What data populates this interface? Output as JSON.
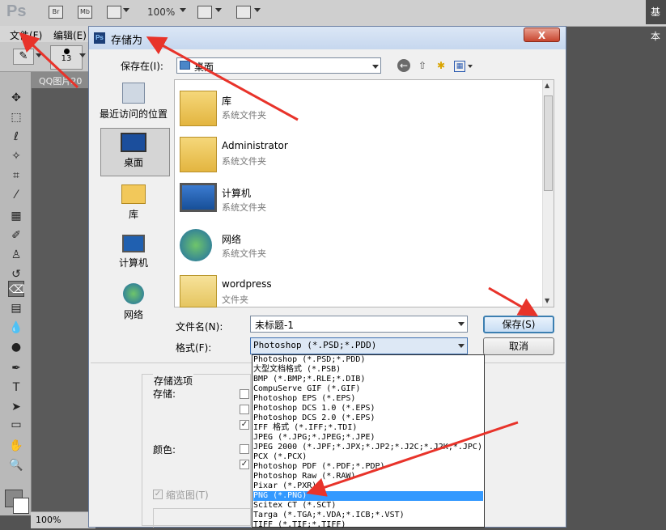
{
  "ps": {
    "logo": "Ps",
    "bridge_label": "Br",
    "minibridge_label": "Mb",
    "zoom": "100%",
    "workspace_label": "基本",
    "menu": [
      "文件(F)",
      "编辑(E)"
    ],
    "brush_size": "13",
    "doc_tab": "QQ图片20",
    "status_zoom": "100%"
  },
  "dialog": {
    "title": "存储为",
    "close_symbol": "X",
    "save_in_label": "保存在(I):",
    "save_in_value": "桌面",
    "places": [
      "最近访问的位置",
      "桌面",
      "库",
      "计算机",
      "网络"
    ],
    "files": [
      {
        "name": "库",
        "type": "系统文件夹"
      },
      {
        "name": "Administrator",
        "type": "系统文件夹"
      },
      {
        "name": "计算机",
        "type": "系统文件夹"
      },
      {
        "name": "网络",
        "type": "系统文件夹"
      },
      {
        "name": "wordpress",
        "type": "文件夹"
      }
    ],
    "filename_label": "文件名(N):",
    "filename_value": "未标题-1",
    "format_label": "格式(F):",
    "format_value": "Photoshop (*.PSD;*.PDD)",
    "save_button": "保存(S)",
    "cancel_button": "取消",
    "options_title": "存储选项",
    "store_label": "存储:",
    "color_label": "颜色:",
    "thumbnail_label": "缩览图(T)",
    "format_options": [
      "Photoshop (*.PSD;*.PDD)",
      "大型文档格式 (*.PSB)",
      "BMP (*.BMP;*.RLE;*.DIB)",
      "CompuServe GIF (*.GIF)",
      "Photoshop EPS (*.EPS)",
      "Photoshop DCS 1.0 (*.EPS)",
      "Photoshop DCS 2.0 (*.EPS)",
      "IFF 格式 (*.IFF;*.TDI)",
      "JPEG (*.JPG;*.JPEG;*.JPE)",
      "JPEG 2000 (*.JPF;*.JPX;*.JP2;*.J2C;*.J2K;*.JPC)",
      "PCX (*.PCX)",
      "Photoshop PDF (*.PDF;*.PDP)",
      "Photoshop Raw (*.RAW)",
      "Pixar (*.PXR)",
      "PNG (*.PNG)",
      "Scitex CT (*.SCT)",
      "Targa (*.TGA;*.VDA;*.ICB;*.VST)",
      "TIFF (*.TIF;*.TIFF)"
    ],
    "selected_format_index": 14
  },
  "colors": {
    "annotation_arrow": "#e8332a",
    "selection_blue": "#3399ff"
  }
}
